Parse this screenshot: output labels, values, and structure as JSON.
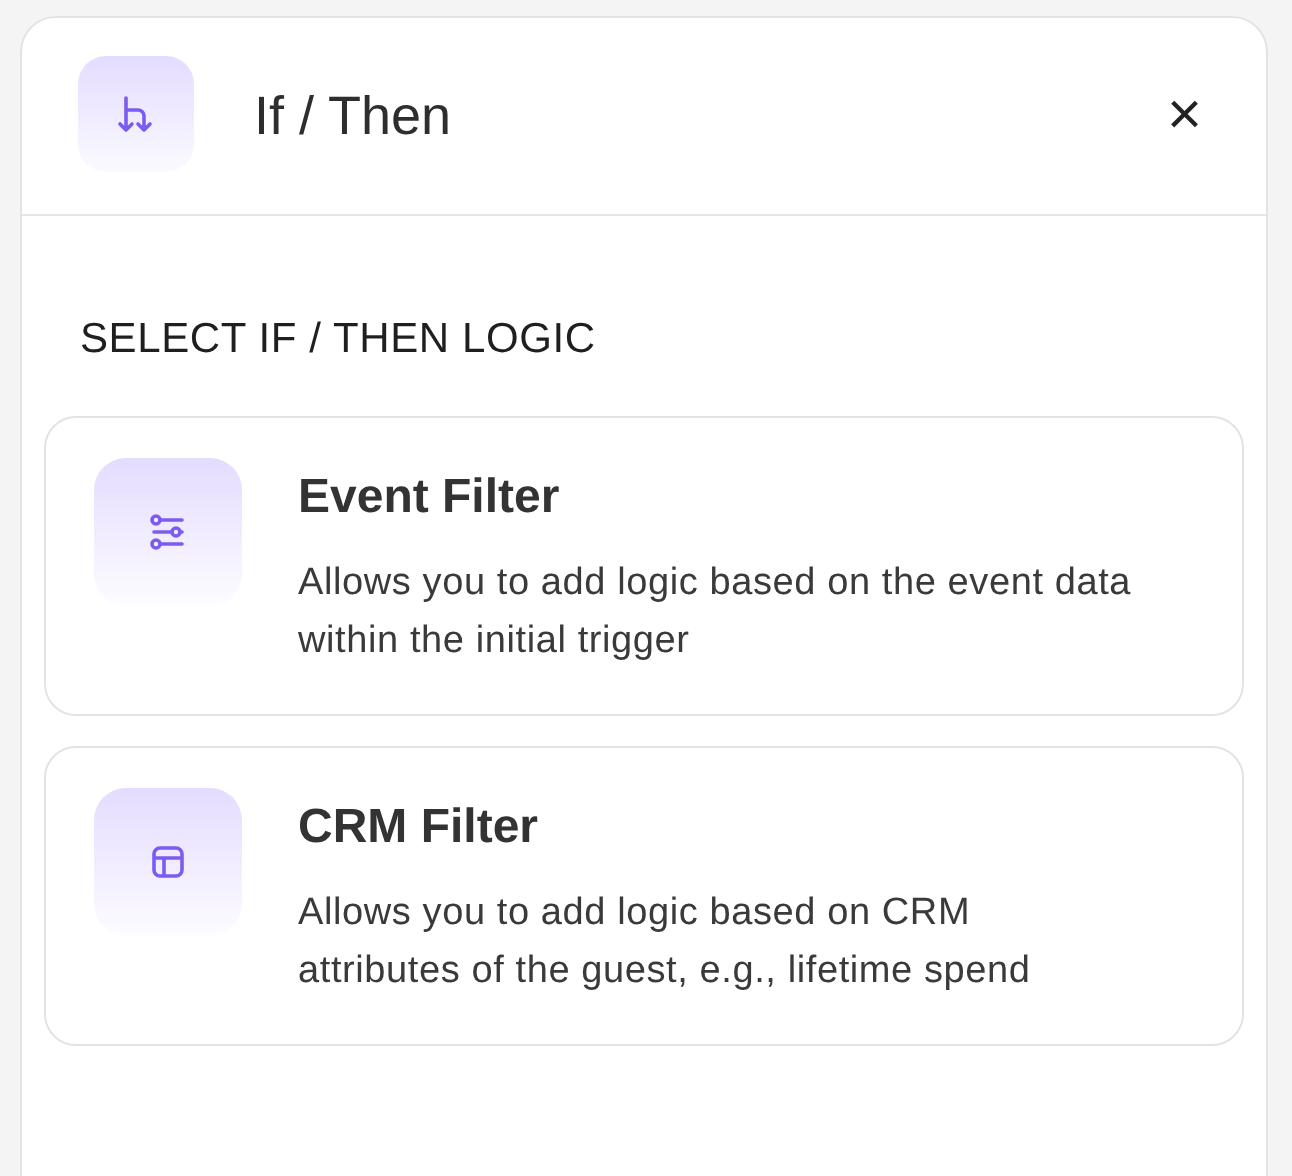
{
  "panel": {
    "title": "If / Then",
    "close": "×"
  },
  "section": {
    "heading": "SELECT IF / THEN LOGIC"
  },
  "options": [
    {
      "kind": "event",
      "title": "Event Filter",
      "description": "Allows you to add logic based on the event data within the initial trigger"
    },
    {
      "kind": "crm",
      "title": "CRM Filter",
      "description": "Allows you to add logic based on CRM attributes of the guest, e.g., lifetime spend"
    }
  ]
}
